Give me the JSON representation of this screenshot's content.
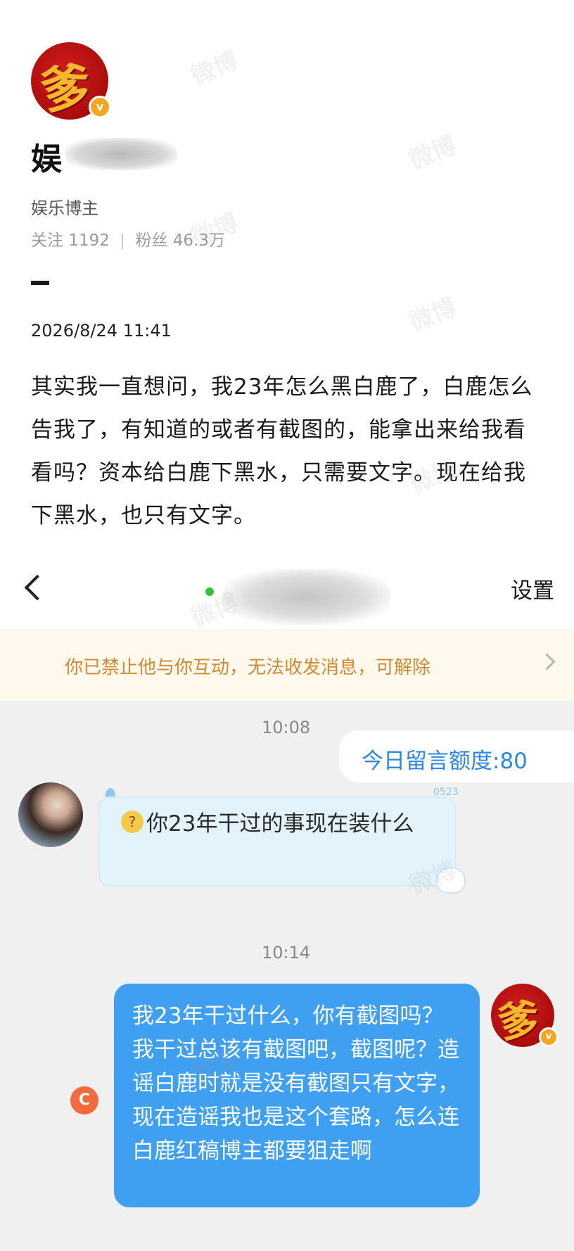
{
  "post": {
    "name_visible": "娱",
    "tag": "娱乐博主",
    "stats": {
      "following_label": "关注",
      "following": "1192",
      "fans_label": "粉丝",
      "fans": "46.3万"
    },
    "dash": "-",
    "time": "2026/8/24 11:41",
    "body": "其实我一直想问，我23年怎么黑白鹿了，白鹿怎么告我了，有知道的或者有截图的，能拿出来给我看看吗？资本给白鹿下黑水，只需要文字。现在给我下黑水，也只有文字。"
  },
  "avatar": {
    "glyph": "爹",
    "badge": "v"
  },
  "chat_header": {
    "settings": "设置"
  },
  "banner": {
    "text": "你已禁止他与你互动，无法收发消息，可解除"
  },
  "messages": {
    "ts1": "10:08",
    "quota": "今日留言额度:80",
    "incoming": "你23年干过的事现在装什么",
    "incoming_emoji": "?",
    "sticker_tag": "0523",
    "ts2": "10:14",
    "outgoing": "我23年干过什么，你有截图吗？我干过总该有截图吧，截图呢？造谣白鹿时就是没有截图只有文字，现在造谣我也是这个套路，怎么连白鹿红稿博主都要狙走啊",
    "retry": "C"
  },
  "watermark": "微博",
  "colors": {
    "accent_blue": "#3f9ff0",
    "banner_text": "#cf8a34",
    "verified_badge": "#f5a623",
    "online_dot": "#35c23b"
  }
}
